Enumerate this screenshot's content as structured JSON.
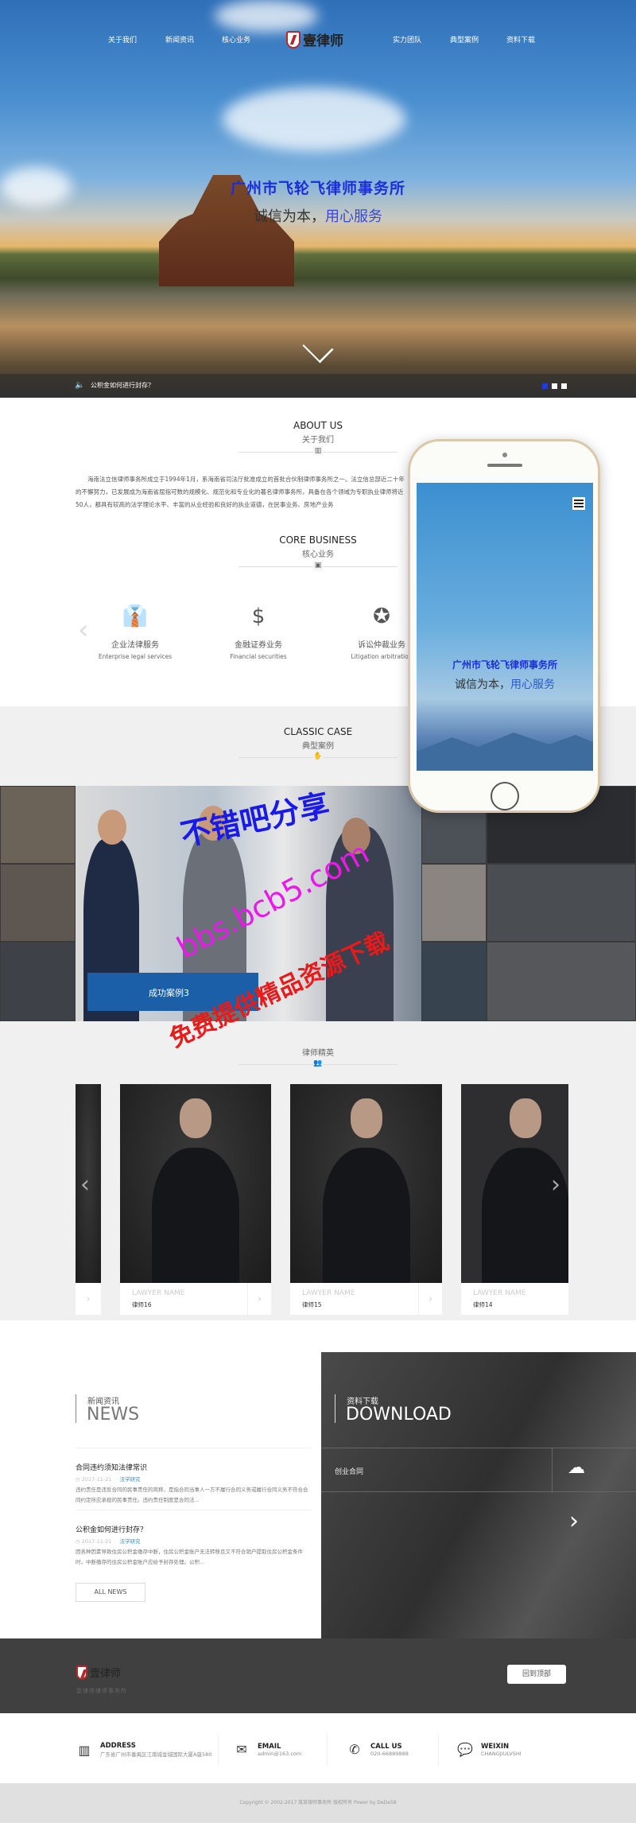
{
  "nav": {
    "left": [
      "关于我们",
      "新闻资讯",
      "核心业务"
    ],
    "right": [
      "实力团队",
      "典型案例",
      "资料下载"
    ],
    "logo_text": "壹律师"
  },
  "hero": {
    "title": "广州市飞轮飞律师事务所",
    "subtitle_a": "诚信为本，",
    "subtitle_b": "用心服务",
    "notice": "公积金如何进行封存？",
    "slide_count": 3,
    "active_slide": 1,
    "accent": "#1a2fd8"
  },
  "about": {
    "title": "ABOUT US",
    "subtitle": "关于我们",
    "text": "海南法立信律师事务所成立于1994年1月，系海南省司法厅批准成立的首批合伙制律师事务所之一。法立信总部近二十年的不懈努力，已发展成为海南省屈指可数的规模化、规范化和专业化的著名律师事务所，具备在各个领域为专职执业律师将近50人，都具有较高的法学理论水平、丰富的从业经验和良好的执业道德，在民事业务、房地产业务"
  },
  "core": {
    "title": "CORE BUSINESS",
    "subtitle": "核心业务",
    "items": [
      {
        "icon": "tie-icon",
        "zh": "企业法律服务",
        "en": "Enterprise legal services"
      },
      {
        "icon": "money-icon",
        "zh": "金融证券业务",
        "en": "Financial securities"
      },
      {
        "icon": "badge-icon",
        "zh": "诉讼仲裁业务",
        "en": "Litigation arbitration"
      }
    ]
  },
  "cases": {
    "title": "CLASSIC CASE",
    "subtitle": "典型案例",
    "caption": "成功案例3",
    "caption_color": "#1a5fa8"
  },
  "phone": {
    "title": "广州市飞轮飞律师事务所",
    "subtitle_a": "诚信为本，",
    "subtitle_b": "用心服务"
  },
  "watermark": {
    "line1": "不错吧分享",
    "line2": "bbs.bcb5.com",
    "line3": "免费提供精品资源下载"
  },
  "lawyers": {
    "subtitle": "律师精英",
    "cards": [
      {
        "label": "LAWYER NAME",
        "name": "律师16"
      },
      {
        "label": "LAWYER NAME",
        "name": "律师15"
      },
      {
        "label": "LAWYER NAME",
        "name": "律师14"
      }
    ]
  },
  "news": {
    "zh": "新闻资讯",
    "en": "NEWS",
    "items": [
      {
        "title": "合同违约须知法律常识",
        "date": "2017-11-21",
        "tag": "法学研究",
        "summary": "违约责任是违反合同的民事责任的简称，是指合同当事人一方不履行合同义务或履行合同义务不符合合同约定所应承担的民事责任。违约责任制度是合同法..."
      },
      {
        "title": "公积金如何进行封存？",
        "date": "2017-11-21",
        "tag": "法学研究",
        "summary": "因各种因素导致住房公积金缴存中断，住房公积金账户无法转移且又不符合销户提取住房公积金条件时，中断缴存的住房公积金账户应给予封存处理。公积..."
      }
    ],
    "all_label": "ALL NEWS"
  },
  "download": {
    "zh": "资料下载",
    "en": "DOWNLOAD",
    "items": [
      "创业合同"
    ]
  },
  "footer": {
    "slogan": "壹律师律师事务所",
    "top_label": "回到顶部"
  },
  "contact": [
    {
      "icon": "map-icon",
      "label": "ADDRESS",
      "value": "广东省广州市番禺区江南城金城国际大厦A座580"
    },
    {
      "icon": "mail-icon",
      "label": "EMAIL",
      "value": "admin@163.com"
    },
    {
      "icon": "phone-icon",
      "label": "CALL US",
      "value": "020-66889888"
    },
    {
      "icon": "wechat-icon",
      "label": "WEIXIN",
      "value": "CHANGJIULVSHI"
    }
  ],
  "copyright": "Copyright © 2002-2017 某某律师事务所 版权所有 Power by DeDe58"
}
